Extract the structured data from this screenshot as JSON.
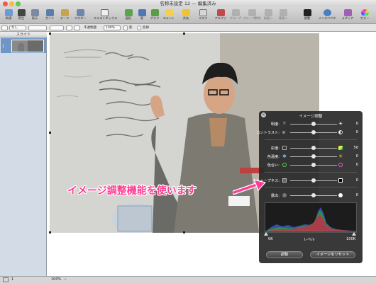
{
  "window": {
    "title": "名称未設定 12 — 編集済み"
  },
  "toolbar": {
    "items": [
      {
        "label": "新規",
        "icon": "new-icon"
      },
      {
        "label": "再生",
        "icon": "play-icon"
      },
      {
        "label": "表示",
        "icon": "view-icon"
      },
      {
        "label": "ガイド",
        "icon": "guide-icon"
      },
      {
        "label": "テーマ",
        "icon": "theme-icon"
      },
      {
        "label": "マスター",
        "icon": "master-icon"
      },
      {
        "label": "テキストボックス",
        "icon": "textbox-icon"
      },
      {
        "label": "図形",
        "icon": "shape-icon"
      },
      {
        "label": "表",
        "icon": "table-icon"
      },
      {
        "label": "グラフ",
        "icon": "chart-icon"
      },
      {
        "label": "コメント",
        "icon": "comment-icon"
      },
      {
        "label": "共有",
        "icon": "share-icon"
      },
      {
        "label": "マスク",
        "icon": "mask-icon"
      },
      {
        "label": "アルファ",
        "icon": "alpha-icon"
      },
      {
        "label": "グループ",
        "icon": "group-icon"
      },
      {
        "label": "グループ解除",
        "icon": "ungroup-icon"
      },
      {
        "label": "前面へ",
        "icon": "front-icon"
      },
      {
        "label": "背面へ",
        "icon": "back-icon"
      },
      {
        "label": "調整",
        "icon": "adjust-icon"
      },
      {
        "label": "インスペクタ",
        "icon": "inspector-icon"
      },
      {
        "label": "メディア",
        "icon": "media-icon"
      },
      {
        "label": "カラー",
        "icon": "color-icon"
      }
    ]
  },
  "format_bar": {
    "stroke": "なし",
    "opacity_label": "不透明度:",
    "opacity_value": "100%",
    "shadow": "影",
    "reflection": "反射"
  },
  "sidebar": {
    "header": "スライド",
    "slide_number": "1"
  },
  "status": {
    "zoom": "100%",
    "slide_count": "1"
  },
  "hud": {
    "title": "イメージ調整",
    "rows": [
      {
        "label": "明度:",
        "value": "0",
        "level": 0.5
      },
      {
        "label": "コントラスト:",
        "value": "0",
        "level": 0.5
      },
      {
        "label": "彩度:",
        "value": "50",
        "level": 0.5
      },
      {
        "label": "色温度:",
        "value": "0",
        "level": 0.5
      },
      {
        "label": "色合い:",
        "value": "0",
        "level": 0.5
      },
      {
        "label": "シャープネス:",
        "value": "0",
        "level": 0.5
      },
      {
        "label": "露出:",
        "value": "0",
        "level": 0.5
      }
    ],
    "levels": {
      "min_label": "0K",
      "center_label": "レベル",
      "max_label": "100K"
    },
    "buttons": {
      "auto": "調整",
      "reset": "イメージをリセット"
    }
  },
  "annotation": "イメージ調整機能を使います",
  "colors": {
    "annotation": "#ff3d93",
    "hud_bg": "#282828",
    "selection": "#6f96c6"
  }
}
